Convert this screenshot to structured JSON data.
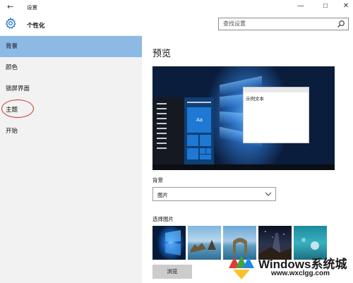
{
  "window": {
    "back_glyph": "←",
    "title": "设置",
    "minimize_glyph": "—",
    "maximize_glyph": "☐",
    "close_glyph": "✕"
  },
  "header": {
    "icon": "gear-icon",
    "section_title": "个性化",
    "search_placeholder": "查找设置",
    "search_icon": "search-icon"
  },
  "sidebar": {
    "items": [
      {
        "label": "背景",
        "active": true
      },
      {
        "label": "颜色",
        "active": false
      },
      {
        "label": "锁屏界面",
        "active": false
      },
      {
        "label": "主题",
        "active": false,
        "annotated": true
      },
      {
        "label": "开始",
        "active": false
      }
    ],
    "active_color": "#8cbae5",
    "annotation_color": "#c0392b"
  },
  "main": {
    "title": "预览",
    "preview": {
      "sample_text": "示例文本",
      "tile_label": "Aa"
    },
    "background_label": "背景",
    "background_value": "图片",
    "choose_picture_label": "选择图片",
    "browse_button": "浏览",
    "thumbnails": [
      "windows-hero",
      "beach-rocks",
      "sea-arch",
      "night-sky",
      "underwater"
    ]
  },
  "watermark": {
    "title": "Windows系统城",
    "url": "www.wxclgg.com"
  }
}
